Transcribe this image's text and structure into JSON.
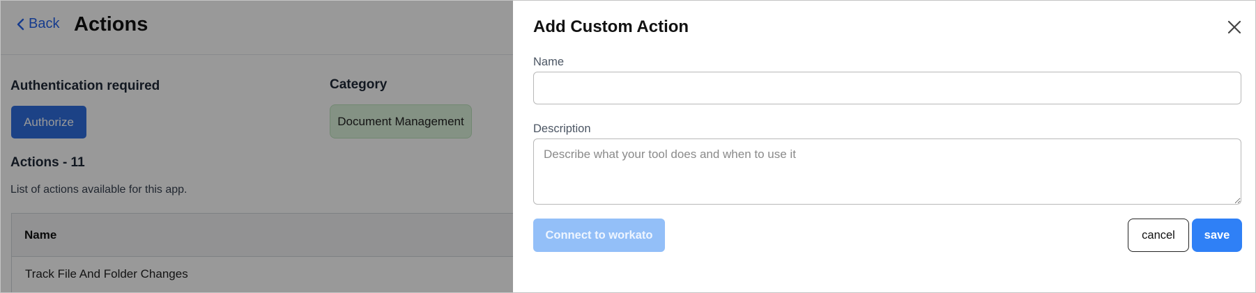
{
  "background": {
    "back_label": "Back",
    "page_title": "Actions",
    "auth_label": "Authentication required",
    "authorize_label": "Authorize",
    "category_label": "Category",
    "category_value": "Document Management",
    "actions_title": "Actions - 11",
    "actions_subtitle": "List of actions available for this app.",
    "table": {
      "header_name": "Name",
      "rows": [
        "Track File And Folder Changes"
      ]
    }
  },
  "drawer": {
    "title": "Add Custom Action",
    "name_label": "Name",
    "name_value": "",
    "description_label": "Description",
    "description_placeholder": "Describe what your tool does and when to use it",
    "connect_label": "Connect to workato",
    "cancel_label": "cancel",
    "save_label": "save"
  },
  "colors": {
    "accent": "#2f80f6",
    "authorize": "#2f6ee0",
    "connect_disabled": "#93bff8",
    "category_chip": "#dcf3dc"
  },
  "icons": [
    "chevron-left-icon",
    "close-icon"
  ]
}
